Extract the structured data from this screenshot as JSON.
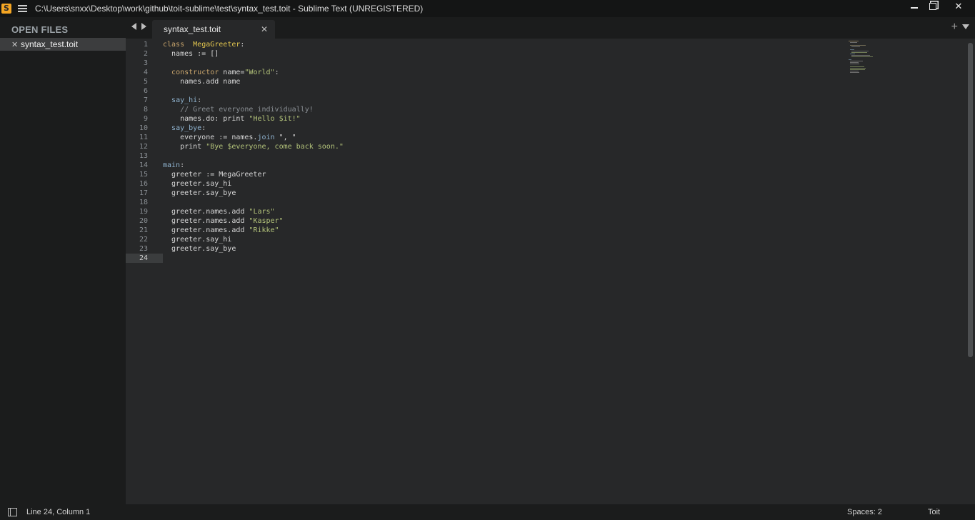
{
  "titlebar": {
    "title": "C:\\Users\\snxx\\Desktop\\work\\github\\toit-sublime\\test\\syntax_test.toit - Sublime Text (UNREGISTERED)",
    "logo_glyph": "S",
    "minimize": "minimize-icon",
    "maximize": "restore-icon",
    "close": "✕"
  },
  "sidebar": {
    "title": "OPEN FILES",
    "files": [
      {
        "close": "✕",
        "name": "syntax_test.toit"
      }
    ]
  },
  "tabs": [
    {
      "label": "syntax_test.toit",
      "close": "✕"
    }
  ],
  "tabbar": {
    "plus": "+"
  },
  "editor": {
    "current_line": 24,
    "lines": [
      {
        "num": "1",
        "segs": [
          [
            "kw",
            "class"
          ],
          [
            "",
            "  "
          ],
          [
            "cls",
            "MegaGreeter"
          ],
          [
            "",
            ":"
          ]
        ]
      },
      {
        "num": "2",
        "segs": [
          [
            "",
            "  names := []"
          ]
        ]
      },
      {
        "num": "3",
        "segs": []
      },
      {
        "num": "4",
        "segs": [
          [
            "",
            "  "
          ],
          [
            "kw",
            "constructor"
          ],
          [
            "",
            " name="
          ],
          [
            "str",
            "\"World\""
          ],
          [
            "",
            ":"
          ]
        ]
      },
      {
        "num": "5",
        "segs": [
          [
            "",
            "    names.add name"
          ]
        ]
      },
      {
        "num": "6",
        "segs": []
      },
      {
        "num": "7",
        "segs": [
          [
            "",
            "  "
          ],
          [
            "fn",
            "say_hi"
          ],
          [
            "",
            ":"
          ]
        ]
      },
      {
        "num": "8",
        "segs": [
          [
            "",
            "    "
          ],
          [
            "cmt",
            "// Greet everyone individually!"
          ]
        ]
      },
      {
        "num": "9",
        "segs": [
          [
            "",
            "    names.do: print "
          ],
          [
            "str",
            "\"Hello $it!\""
          ]
        ]
      },
      {
        "num": "10",
        "segs": [
          [
            "",
            "  "
          ],
          [
            "fn",
            "say_bye"
          ],
          [
            "",
            ":"
          ]
        ]
      },
      {
        "num": "11",
        "segs": [
          [
            "",
            "    everyone := names."
          ],
          [
            "fn",
            "join"
          ],
          [
            "",
            " \", \""
          ]
        ]
      },
      {
        "num": "12",
        "segs": [
          [
            "",
            "    print "
          ],
          [
            "str",
            "\"Bye $everyone, come back soon.\""
          ]
        ]
      },
      {
        "num": "13",
        "segs": []
      },
      {
        "num": "14",
        "segs": [
          [
            "fn",
            "main"
          ],
          [
            "",
            ":"
          ]
        ]
      },
      {
        "num": "15",
        "segs": [
          [
            "",
            "  greeter := MegaGreeter"
          ]
        ]
      },
      {
        "num": "16",
        "segs": [
          [
            "",
            "  greeter.say_hi"
          ]
        ]
      },
      {
        "num": "17",
        "segs": [
          [
            "",
            "  greeter.say_bye"
          ]
        ]
      },
      {
        "num": "18",
        "segs": []
      },
      {
        "num": "19",
        "segs": [
          [
            "",
            "  greeter.names.add "
          ],
          [
            "str",
            "\"Lars\""
          ]
        ]
      },
      {
        "num": "20",
        "segs": [
          [
            "",
            "  greeter.names.add "
          ],
          [
            "str",
            "\"Kasper\""
          ]
        ]
      },
      {
        "num": "21",
        "segs": [
          [
            "",
            "  greeter.names.add "
          ],
          [
            "str",
            "\"Rikke\""
          ]
        ]
      },
      {
        "num": "22",
        "segs": [
          [
            "",
            "  greeter.say_hi"
          ]
        ]
      },
      {
        "num": "23",
        "segs": [
          [
            "",
            "  greeter.say_bye"
          ]
        ]
      },
      {
        "num": "24",
        "segs": []
      }
    ]
  },
  "colors": {
    "keyword": "#c8a46c",
    "class_name": "#e3c74f",
    "function": "#8fb3cf",
    "string": "#b3c37a",
    "comment": "#8a8f94"
  },
  "statusbar": {
    "position": "Line 24, Column 1",
    "spaces": "Spaces: 2",
    "syntax": "Toit"
  }
}
